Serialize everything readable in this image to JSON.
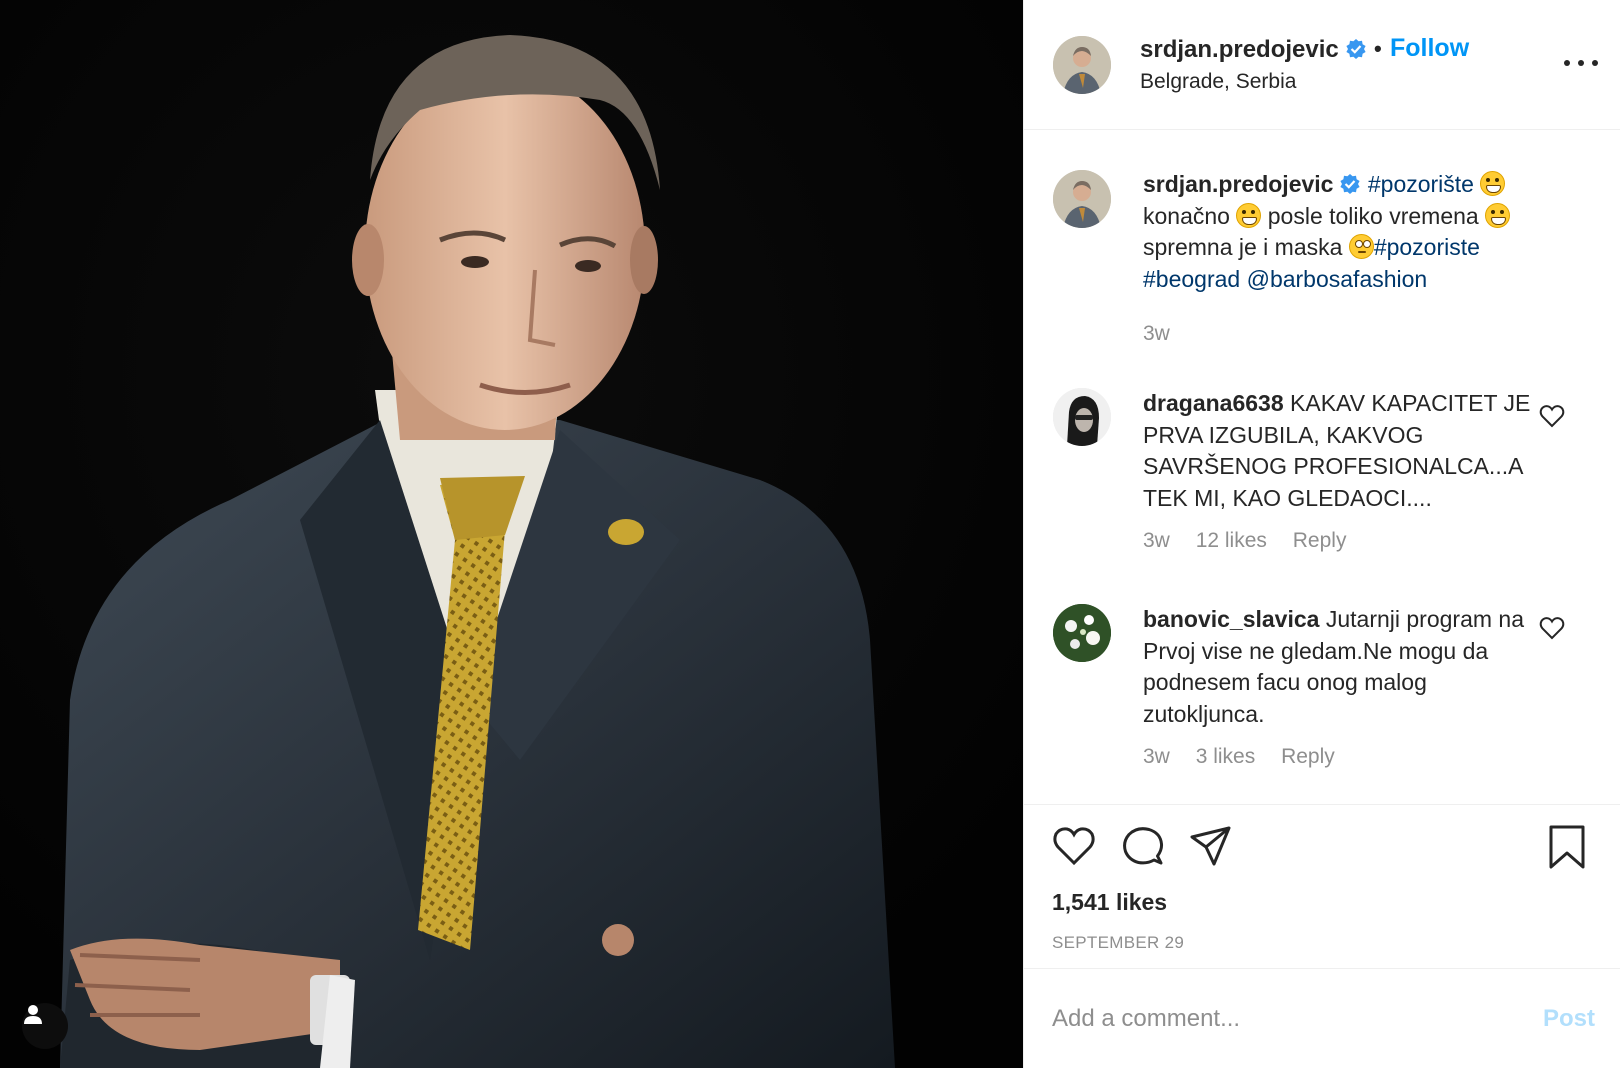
{
  "post": {
    "image_alt": "Man in dark suit and gold tie with crossed arms on black background",
    "tag_icon": "user-tag-icon"
  },
  "header": {
    "username": "srdjan.predojevic",
    "verified_icon": "verified-badge-icon",
    "separator": "•",
    "follow_label": "Follow",
    "location": "Belgrade, Serbia",
    "more_icon": "more-options-icon"
  },
  "caption": {
    "username": "srdjan.predojevic",
    "hashtag1": "#pozorište",
    "text1": "konačno",
    "text2": "posle toliko vremena",
    "text3": "spremna je i maska",
    "hashtag2": "#pozoriste",
    "hashtag3": "#beograd",
    "mention": "@barbosafashion",
    "time": "3w"
  },
  "comments": [
    {
      "username": "dragana6638",
      "text": "KAKAV KAPACITET JE PRVA IZGUBILA, KAKVOG SAVRŠENOG PROFESIONALCA...A TEK MI, KAO GLEDAOCI....",
      "time": "3w",
      "likes": "12 likes",
      "reply": "Reply"
    },
    {
      "username": "banovic_slavica",
      "text": "Jutarnji program na Prvoj vise ne gledam.Ne mogu da podnesem facu onog malog zutokljunca.",
      "time": "3w",
      "likes": "3 likes",
      "reply": "Reply"
    }
  ],
  "actions": {
    "icons": [
      "heart-icon",
      "comment-icon",
      "share-icon",
      "bookmark-icon"
    ],
    "likes": "1,541 likes",
    "date": "SEPTEMBER 29"
  },
  "comment_box": {
    "placeholder": "Add a comment...",
    "post_label": "Post"
  },
  "colors": {
    "link_blue": "#0095f6",
    "hashtag": "#00376b",
    "muted": "#8e8e8e",
    "post_disabled": "#b2dffc"
  }
}
